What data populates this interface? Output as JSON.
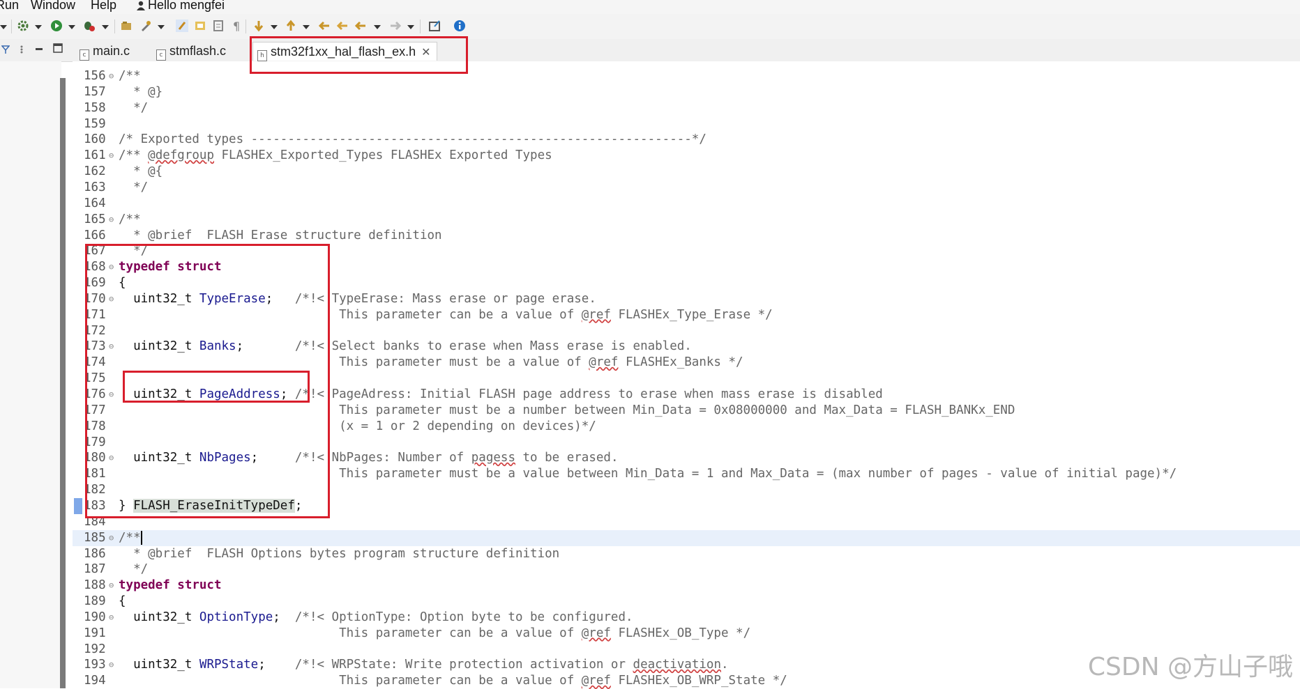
{
  "menubar": {
    "items": [
      "Run",
      "Window",
      "Help"
    ],
    "user_greeting": "Hello mengfei"
  },
  "tabs": [
    {
      "label": "main.c",
      "active": false,
      "file_icon": "c-file-icon"
    },
    {
      "label": "stmflash.c",
      "active": false,
      "file_icon": "c-file-icon"
    },
    {
      "label": "stm32f1xx_hal_flash_ex.h",
      "active": true,
      "file_icon": "h-file-icon"
    }
  ],
  "colors": {
    "annotation_red": "#d81e2c",
    "keyword": "#7f0055",
    "identifier": "#1a1a8f",
    "comment": "#666666"
  },
  "code_lines": [
    {
      "num": "156",
      "fold": true,
      "segments": [
        {
          "t": "/**",
          "c": "cmt"
        }
      ]
    },
    {
      "num": "157",
      "fold": false,
      "segments": [
        {
          "t": "  * @}",
          "c": "cmt"
        }
      ]
    },
    {
      "num": "158",
      "fold": false,
      "segments": [
        {
          "t": "  */",
          "c": "cmt"
        }
      ]
    },
    {
      "num": "159",
      "fold": false,
      "segments": []
    },
    {
      "num": "160",
      "fold": false,
      "segments": [
        {
          "t": "/* Exported types ------------------------------------------------------------*/",
          "c": "cmt"
        }
      ]
    },
    {
      "num": "161",
      "fold": true,
      "segments": [
        {
          "t": "/** ",
          "c": "cmt"
        },
        {
          "t": "@defgroup",
          "c": "cmt ul"
        },
        {
          "t": " FLASHEx_Exported_Types FLASHEx Exported Types",
          "c": "cmt"
        }
      ]
    },
    {
      "num": "162",
      "fold": false,
      "segments": [
        {
          "t": "  * @{",
          "c": "cmt"
        }
      ]
    },
    {
      "num": "163",
      "fold": false,
      "segments": [
        {
          "t": "  */",
          "c": "cmt"
        }
      ]
    },
    {
      "num": "164",
      "fold": false,
      "segments": []
    },
    {
      "num": "165",
      "fold": true,
      "segments": [
        {
          "t": "/**",
          "c": "cmt"
        }
      ]
    },
    {
      "num": "166",
      "fold": false,
      "segments": [
        {
          "t": "  * @brief  FLASH Erase structure definition",
          "c": "cmt"
        }
      ]
    },
    {
      "num": "167",
      "fold": false,
      "segments": [
        {
          "t": "  */",
          "c": "cmt"
        }
      ]
    },
    {
      "num": "168",
      "fold": true,
      "segments": [
        {
          "t": "typedef struct",
          "c": "kw"
        }
      ]
    },
    {
      "num": "169",
      "fold": false,
      "segments": [
        {
          "t": "{",
          "c": "ty"
        }
      ]
    },
    {
      "num": "170",
      "fold": true,
      "segments": [
        {
          "t": "  uint32_t ",
          "c": "ty"
        },
        {
          "t": "TypeErase",
          "c": "id"
        },
        {
          "t": ";   ",
          "c": "ty"
        },
        {
          "t": "/*!< TypeErase: Mass erase or page erase.",
          "c": "cmt"
        }
      ]
    },
    {
      "num": "171",
      "fold": false,
      "segments": [
        {
          "t": "                              This parameter can be a value of ",
          "c": "cmt"
        },
        {
          "t": "@ref",
          "c": "cmt ul"
        },
        {
          "t": " FLASHEx_Type_Erase */",
          "c": "cmt"
        }
      ]
    },
    {
      "num": "172",
      "fold": false,
      "segments": []
    },
    {
      "num": "173",
      "fold": true,
      "segments": [
        {
          "t": "  uint32_t ",
          "c": "ty"
        },
        {
          "t": "Banks",
          "c": "id"
        },
        {
          "t": ";       ",
          "c": "ty"
        },
        {
          "t": "/*!< Select banks to erase when Mass erase is enabled.",
          "c": "cmt"
        }
      ]
    },
    {
      "num": "174",
      "fold": false,
      "segments": [
        {
          "t": "                              This parameter must be a value of ",
          "c": "cmt"
        },
        {
          "t": "@ref",
          "c": "cmt ul"
        },
        {
          "t": " FLASHEx_Banks */",
          "c": "cmt"
        }
      ]
    },
    {
      "num": "175",
      "fold": false,
      "segments": []
    },
    {
      "num": "176",
      "fold": true,
      "segments": [
        {
          "t": "  uint32_t ",
          "c": "ty"
        },
        {
          "t": "PageAddress",
          "c": "id"
        },
        {
          "t": "; ",
          "c": "ty"
        },
        {
          "t": "/*!< PageAdress: Initial FLASH page address to erase when mass erase is disabled",
          "c": "cmt"
        }
      ]
    },
    {
      "num": "177",
      "fold": false,
      "segments": [
        {
          "t": "                              This parameter must be a number between Min_Data = 0x08000000 and Max_Data = FLASH_BANKx_END",
          "c": "cmt"
        }
      ]
    },
    {
      "num": "178",
      "fold": false,
      "segments": [
        {
          "t": "                              (x = 1 or 2 depending on devices)*/",
          "c": "cmt"
        }
      ]
    },
    {
      "num": "179",
      "fold": false,
      "segments": []
    },
    {
      "num": "180",
      "fold": true,
      "segments": [
        {
          "t": "  uint32_t ",
          "c": "ty"
        },
        {
          "t": "NbPages",
          "c": "id"
        },
        {
          "t": ";     ",
          "c": "ty"
        },
        {
          "t": "/*!< NbPages: Number of ",
          "c": "cmt"
        },
        {
          "t": "pagess",
          "c": "cmt ul"
        },
        {
          "t": " to be erased.",
          "c": "cmt"
        }
      ]
    },
    {
      "num": "181",
      "fold": false,
      "segments": [
        {
          "t": "                              This parameter must be a value between Min_Data = 1 and Max_Data = (max number of pages - value of initial page)*/",
          "c": "cmt"
        }
      ]
    },
    {
      "num": "182",
      "fold": false,
      "segments": []
    },
    {
      "num": "183",
      "fold": false,
      "segments": [
        {
          "t": "} ",
          "c": "ty"
        },
        {
          "t": "FLASH_EraseInitTypeDef",
          "c": "ty hl"
        },
        {
          "t": ";",
          "c": "ty"
        }
      ]
    },
    {
      "num": "184",
      "fold": false,
      "segments": []
    },
    {
      "num": "185",
      "fold": true,
      "segments": [
        {
          "t": "/**",
          "c": "cmt"
        }
      ]
    },
    {
      "num": "186",
      "fold": false,
      "segments": [
        {
          "t": "  * @brief  FLASH Options bytes program structure definition",
          "c": "cmt"
        }
      ]
    },
    {
      "num": "187",
      "fold": false,
      "segments": [
        {
          "t": "  */",
          "c": "cmt"
        }
      ]
    },
    {
      "num": "188",
      "fold": true,
      "segments": [
        {
          "t": "typedef struct",
          "c": "kw"
        }
      ]
    },
    {
      "num": "189",
      "fold": false,
      "segments": [
        {
          "t": "{",
          "c": "ty"
        }
      ]
    },
    {
      "num": "190",
      "fold": true,
      "segments": [
        {
          "t": "  uint32_t ",
          "c": "ty"
        },
        {
          "t": "OptionType",
          "c": "id"
        },
        {
          "t": ";  ",
          "c": "ty"
        },
        {
          "t": "/*!< OptionType: Option byte to be configured.",
          "c": "cmt"
        }
      ]
    },
    {
      "num": "191",
      "fold": false,
      "segments": [
        {
          "t": "                              This parameter can be a value of ",
          "c": "cmt"
        },
        {
          "t": "@ref",
          "c": "cmt ul"
        },
        {
          "t": " FLASHEx_OB_Type */",
          "c": "cmt"
        }
      ]
    },
    {
      "num": "192",
      "fold": false,
      "segments": []
    },
    {
      "num": "193",
      "fold": true,
      "segments": [
        {
          "t": "  uint32_t ",
          "c": "ty"
        },
        {
          "t": "WRPState",
          "c": "id"
        },
        {
          "t": ";    ",
          "c": "ty"
        },
        {
          "t": "/*!< WRPState: Write protection activation or ",
          "c": "cmt"
        },
        {
          "t": "deactivation",
          "c": "cmt ul"
        },
        {
          "t": ".",
          "c": "cmt"
        }
      ]
    },
    {
      "num": "194",
      "fold": false,
      "segments": [
        {
          "t": "                              This parameter can be a value of ",
          "c": "cmt"
        },
        {
          "t": "@ref",
          "c": "cmt ul"
        },
        {
          "t": " FLASHEx_OB_WRP_State */",
          "c": "cmt"
        }
      ]
    }
  ],
  "watermark": "CSDN @方山子哦"
}
